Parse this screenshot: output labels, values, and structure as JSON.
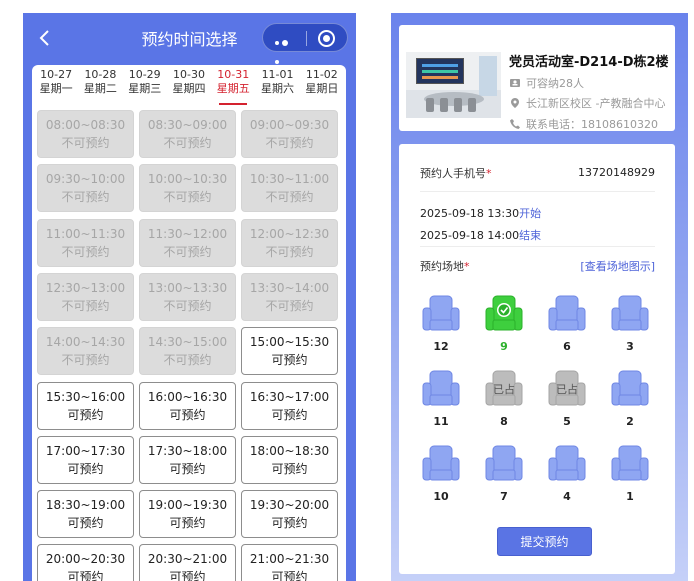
{
  "left": {
    "title": "预约时间选择",
    "dates": [
      {
        "date": "10-27",
        "weekday": "星期一"
      },
      {
        "date": "10-28",
        "weekday": "星期二"
      },
      {
        "date": "10-29",
        "weekday": "星期三"
      },
      {
        "date": "10-30",
        "weekday": "星期四"
      },
      {
        "date": "10-31",
        "weekday": "星期五"
      },
      {
        "date": "11-01",
        "weekday": "星期六"
      },
      {
        "date": "11-02",
        "weekday": "星期日"
      }
    ],
    "active_date_index": 4,
    "slots": [
      {
        "time": "08:00~08:30",
        "status": "不可预约"
      },
      {
        "time": "08:30~09:00",
        "status": "不可预约"
      },
      {
        "time": "09:00~09:30",
        "status": "不可预约"
      },
      {
        "time": "09:30~10:00",
        "status": "不可预约"
      },
      {
        "time": "10:00~10:30",
        "status": "不可预约"
      },
      {
        "time": "10:30~11:00",
        "status": "不可预约"
      },
      {
        "time": "11:00~11:30",
        "status": "不可预约"
      },
      {
        "time": "11:30~12:00",
        "status": "不可预约"
      },
      {
        "time": "12:00~12:30",
        "status": "不可预约"
      },
      {
        "time": "12:30~13:00",
        "status": "不可预约"
      },
      {
        "time": "13:00~13:30",
        "status": "不可预约"
      },
      {
        "time": "13:30~14:00",
        "status": "不可预约"
      },
      {
        "time": "14:00~14:30",
        "status": "不可预约"
      },
      {
        "time": "14:30~15:00",
        "status": "不可预约"
      },
      {
        "time": "15:00~15:30",
        "status": "可预约"
      },
      {
        "time": "15:30~16:00",
        "status": "可预约"
      },
      {
        "time": "16:00~16:30",
        "status": "可预约"
      },
      {
        "time": "16:30~17:00",
        "status": "可预约"
      },
      {
        "time": "17:00~17:30",
        "status": "可预约"
      },
      {
        "time": "17:30~18:00",
        "status": "可预约"
      },
      {
        "time": "18:00~18:30",
        "status": "可预约"
      },
      {
        "time": "18:30~19:00",
        "status": "可预约"
      },
      {
        "time": "19:00~19:30",
        "status": "可预约"
      },
      {
        "time": "19:30~20:00",
        "status": "可预约"
      },
      {
        "time": "20:00~20:30",
        "status": "可预约"
      },
      {
        "time": "20:30~21:00",
        "status": "可预约"
      },
      {
        "time": "21:00~21:30",
        "status": "可预约"
      }
    ]
  },
  "right": {
    "room": {
      "name": "党员活动室-D214-D栋2楼",
      "capacity": "可容纳28人",
      "location": "长江新区校区 -产教融合中心",
      "phone": "联系电话：18108610320"
    },
    "form": {
      "phone_label": "预约人手机号",
      "required_mark": "*",
      "phone_value": "13720148929",
      "start_time": "2025-09-18 13:30",
      "start_label": "开始",
      "end_time": "2025-09-18 14:00",
      "end_label": "结束",
      "venue_label": "预约场地",
      "venue_link": "[查看场地图示]",
      "occupied_label": "已占",
      "seats": [
        {
          "num": "12",
          "state": "free"
        },
        {
          "num": "9",
          "state": "selected"
        },
        {
          "num": "6",
          "state": "free"
        },
        {
          "num": "3",
          "state": "free"
        },
        {
          "num": "11",
          "state": "free"
        },
        {
          "num": "8",
          "state": "occupied"
        },
        {
          "num": "5",
          "state": "occupied"
        },
        {
          "num": "2",
          "state": "free"
        },
        {
          "num": "10",
          "state": "free"
        },
        {
          "num": "7",
          "state": "free"
        },
        {
          "num": "4",
          "state": "free"
        },
        {
          "num": "1",
          "state": "free"
        }
      ],
      "submit_label": "提交预约"
    }
  },
  "colors": {
    "accent": "#5a75e6",
    "active_date": "#d4222f",
    "seat_free": "#8fa6f2",
    "seat_selected": "#3ecf3e",
    "seat_occupied": "#bcbcbc"
  }
}
